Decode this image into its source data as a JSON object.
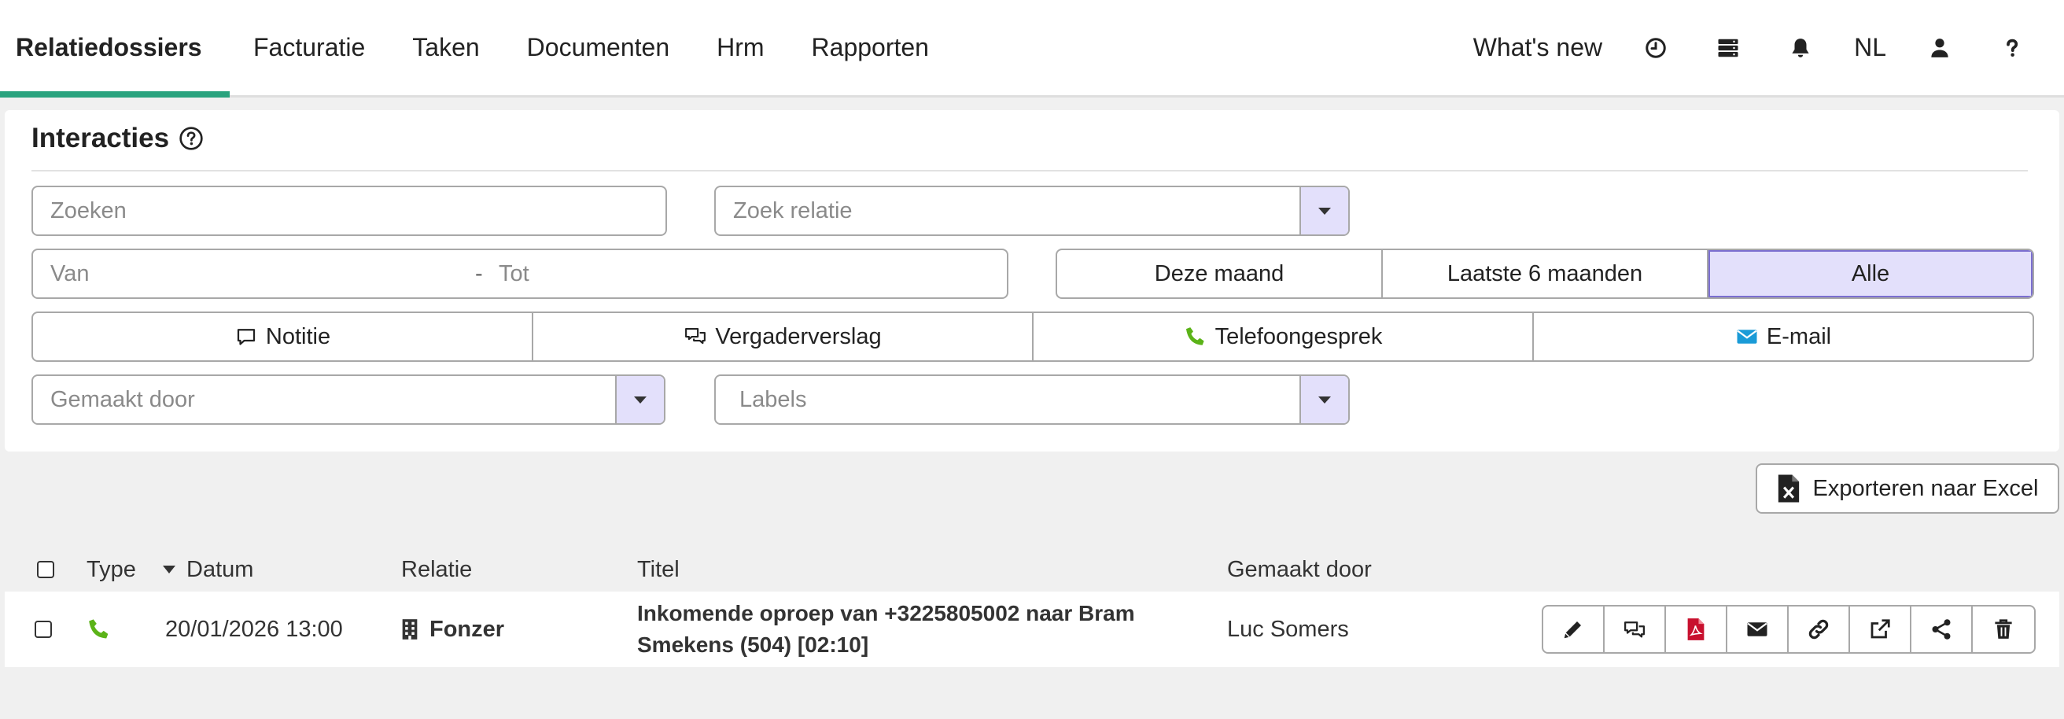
{
  "nav": {
    "items": [
      {
        "label": "Relatiedossiers",
        "active": true
      },
      {
        "label": "Facturatie"
      },
      {
        "label": "Taken"
      },
      {
        "label": "Documenten"
      },
      {
        "label": "Hrm"
      },
      {
        "label": "Rapporten"
      }
    ],
    "whats_new": "What's new",
    "language": "NL",
    "icons": [
      "history-icon",
      "server-icon",
      "bell-icon",
      "user-icon",
      "question-icon"
    ]
  },
  "panel": {
    "title": "Interacties",
    "search_placeholder": "Zoeken",
    "relation_placeholder": "Zoek relatie",
    "from_placeholder": "Van",
    "range_separator": "-",
    "to_placeholder": "Tot",
    "periods": [
      "Deze maand",
      "Laatste 6 maanden",
      "Alle"
    ],
    "selected_period": "Alle",
    "types": [
      {
        "label": "Notitie",
        "icon": "note-icon"
      },
      {
        "label": "Vergaderverslag",
        "icon": "meeting-icon"
      },
      {
        "label": "Telefoongesprek",
        "icon": "phone-icon"
      },
      {
        "label": "E-mail",
        "icon": "envelope-icon"
      }
    ],
    "created_by_placeholder": "Gemaakt door",
    "labels_placeholder": "Labels"
  },
  "export_label": "Exporteren naar Excel",
  "table": {
    "headers": {
      "type": "Type",
      "date": "Datum",
      "relation": "Relatie",
      "title": "Titel",
      "created_by": "Gemaakt door"
    },
    "rows": [
      {
        "type_icon": "phone-icon",
        "date": "20/01/2026 13:00",
        "relation": "Fonzer",
        "title": "Inkomende oproep van +3225805002 naar Bram Smekens (504) [02:10]",
        "created_by": "Luc Somers"
      }
    ],
    "actions": [
      "pencil-icon",
      "comments-icon",
      "pdf-icon",
      "envelope-icon",
      "link-icon",
      "external-link-icon",
      "share-icon",
      "trash-icon"
    ]
  },
  "colors": {
    "accent": "#2aa37e",
    "selected_bg": "#e3e0fb",
    "phone_green": "#5bb318",
    "email_blue": "#1a9bd7",
    "pdf_red": "#c8102e"
  }
}
